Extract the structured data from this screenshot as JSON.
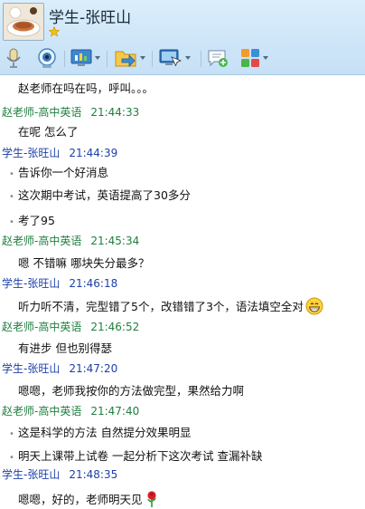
{
  "header": {
    "contact_name": "学生-张旺山"
  },
  "toolbar": {
    "icons": [
      "microphone-icon",
      "video-camera-icon",
      "screen-share-icon",
      "file-transfer-icon",
      "remote-assist-icon",
      "add-chat-icon",
      "app-grid-icon"
    ]
  },
  "messages": [
    {
      "type": "msg",
      "text": "赵老师在吗在吗，呼叫。。。",
      "bullet": false
    },
    {
      "type": "sender",
      "role": "teacher",
      "name": "赵老师-高中英语",
      "time": "21:44:33"
    },
    {
      "type": "msg",
      "text": "在呢 怎么了",
      "bullet": false
    },
    {
      "type": "sender",
      "role": "student",
      "name": "学生-张旺山",
      "time": "21:44:39"
    },
    {
      "type": "msg",
      "text": "告诉你一个好消息",
      "bullet": true
    },
    {
      "type": "msg",
      "text": "这次期中考试，英语提高了30多分",
      "bullet": true
    },
    {
      "type": "msg",
      "text": "考了95",
      "bullet": true
    },
    {
      "type": "sender",
      "role": "teacher",
      "name": "赵老师-高中英语",
      "time": "21:45:34"
    },
    {
      "type": "msg",
      "text": "嗯 不错嘛 哪块失分最多？",
      "bullet": false
    },
    {
      "type": "sender",
      "role": "student",
      "name": "学生-张旺山",
      "time": "21:46:18"
    },
    {
      "type": "msg",
      "text": "听力听不清，完型错了5个，改错错了3个，语法填空全对",
      "bullet": false,
      "emoji": "grin"
    },
    {
      "type": "sender",
      "role": "teacher",
      "name": "赵老师-高中英语",
      "time": "21:46:52"
    },
    {
      "type": "msg",
      "text": "有进步 但也别得瑟",
      "bullet": false
    },
    {
      "type": "sender",
      "role": "student",
      "name": "学生-张旺山",
      "time": "21:47:20"
    },
    {
      "type": "msg",
      "text": "嗯嗯，老师我按你的方法做完型，果然给力啊",
      "bullet": false
    },
    {
      "type": "sender",
      "role": "teacher",
      "name": "赵老师-高中英语",
      "time": "21:47:40"
    },
    {
      "type": "msg",
      "text": "这是科学的方法 自然提分效果明显",
      "bullet": true
    },
    {
      "type": "msg",
      "text": "明天上课带上试卷 一起分析下这次考试 查漏补缺",
      "bullet": true
    },
    {
      "type": "sender",
      "role": "student",
      "name": "学生-张旺山",
      "time": "21:48:35"
    },
    {
      "type": "msg",
      "text": "嗯嗯，好的，老师明天见",
      "bullet": false,
      "emoji": "rose"
    }
  ]
}
